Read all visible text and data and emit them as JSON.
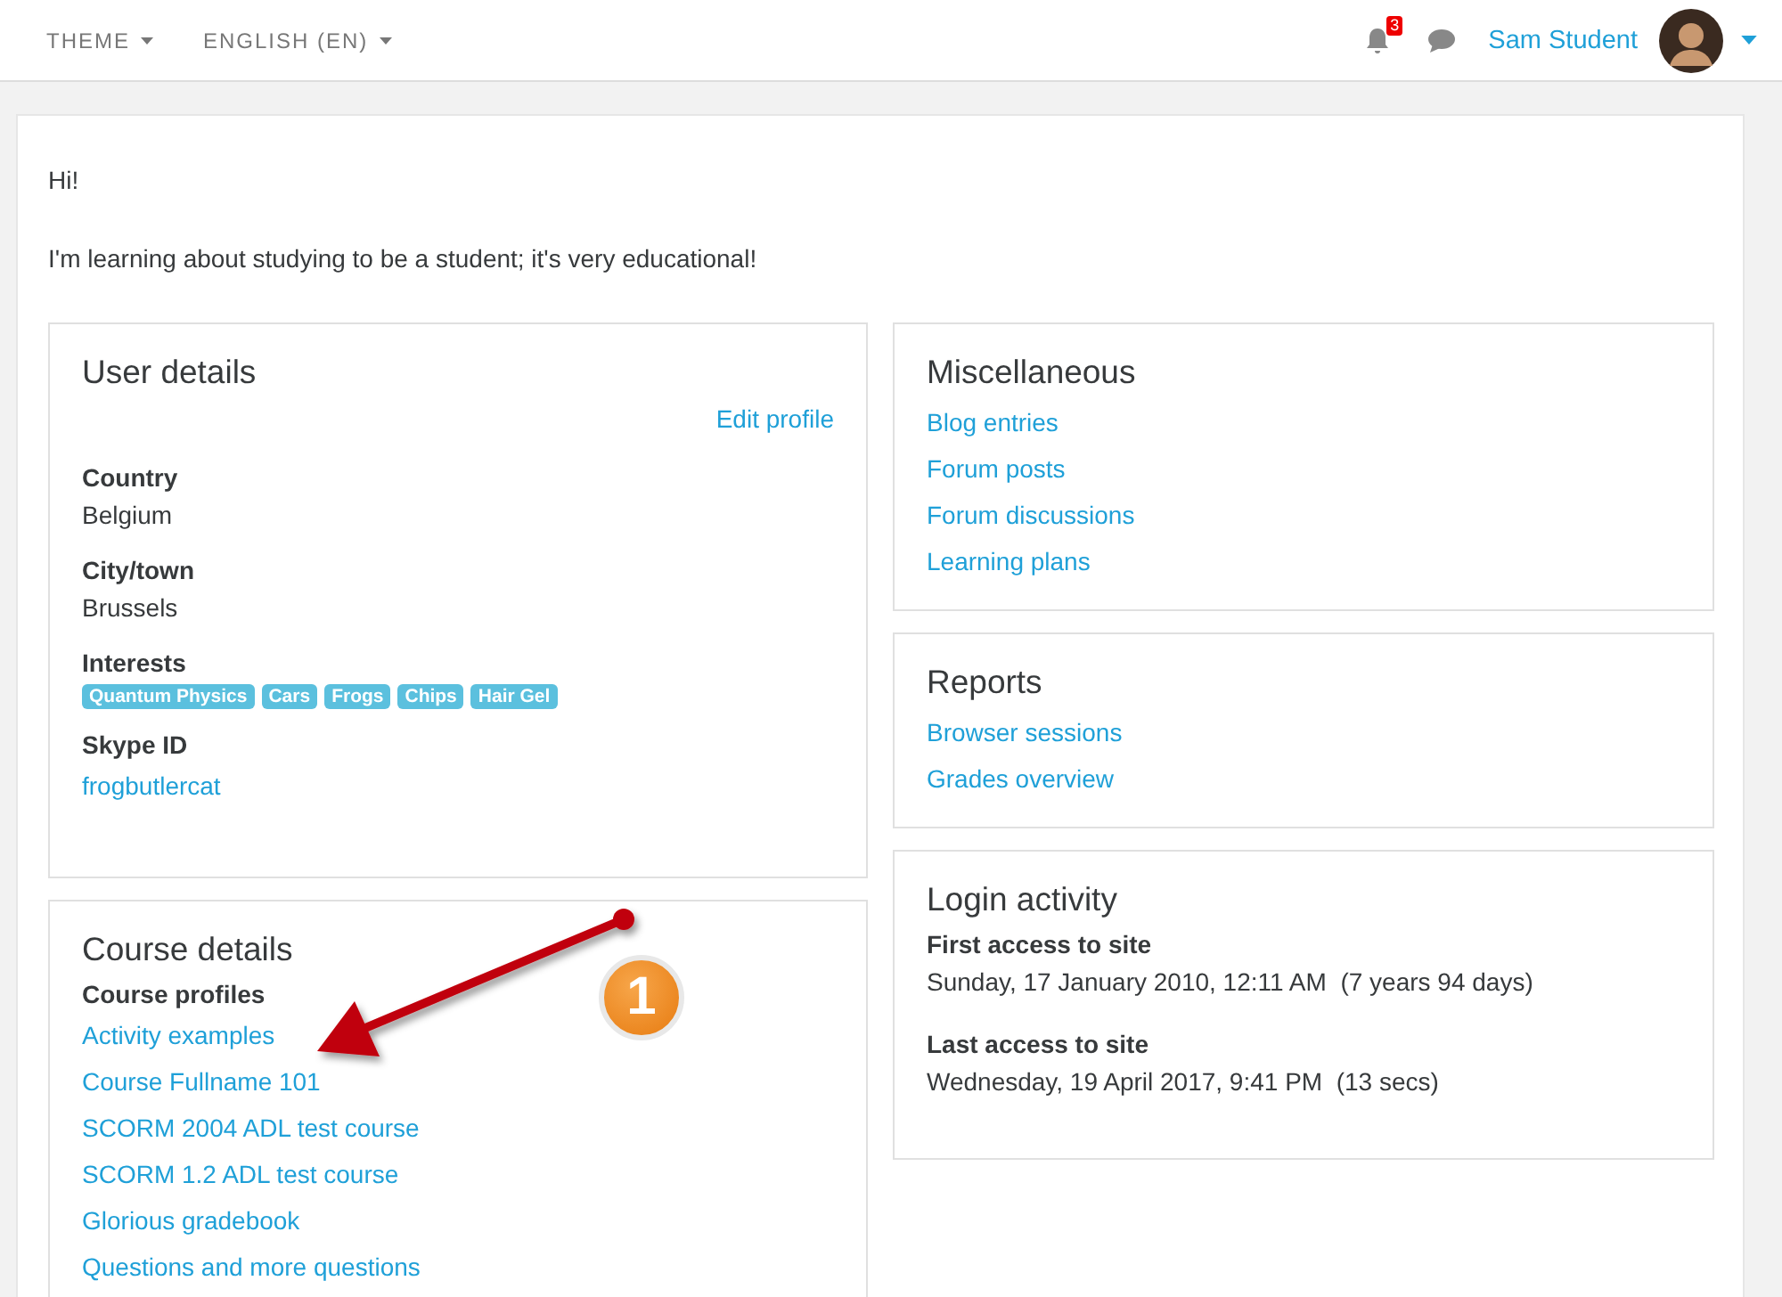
{
  "navbar": {
    "menus": [
      "THEME",
      "ENGLISH (EN)"
    ],
    "notification_count": "3",
    "user_name": "Sam Student"
  },
  "intro": [
    "Hi!",
    "I'm learning about studying to be a student; it's very educational!"
  ],
  "user_details": {
    "title": "User details",
    "edit_link": "Edit profile",
    "fields": [
      {
        "kind": "text",
        "label": "Country",
        "value": "Belgium"
      },
      {
        "kind": "text",
        "label": "City/town",
        "value": "Brussels"
      },
      {
        "kind": "tags",
        "label": "Interests",
        "tags": [
          "Quantum Physics",
          "Cars",
          "Frogs",
          "Chips",
          "Hair Gel"
        ]
      },
      {
        "kind": "link",
        "label": "Skype ID",
        "value": "frogbutlercat"
      }
    ]
  },
  "course_details": {
    "title": "Course details",
    "subtitle": "Course profiles",
    "links": [
      "Activity examples",
      "Course Fullname 101",
      "SCORM 2004 ADL test course",
      "SCORM 1.2 ADL test course",
      "Glorious gradebook",
      "Questions and more questions"
    ]
  },
  "miscellaneous": {
    "title": "Miscellaneous",
    "links": [
      "Blog entries",
      "Forum posts",
      "Forum discussions",
      "Learning plans"
    ]
  },
  "reports": {
    "title": "Reports",
    "links": [
      "Browser sessions",
      "Grades overview"
    ]
  },
  "login_activity": {
    "title": "Login activity",
    "items": [
      {
        "label": "First access to site",
        "value": "Sunday, 17 January 2010, 12:11 AM  (7 years 94 days)"
      },
      {
        "label": "Last access to site",
        "value": "Wednesday, 19 April 2017, 9:41 PM  (13 secs)"
      }
    ]
  },
  "annotation": {
    "badge": "1"
  }
}
